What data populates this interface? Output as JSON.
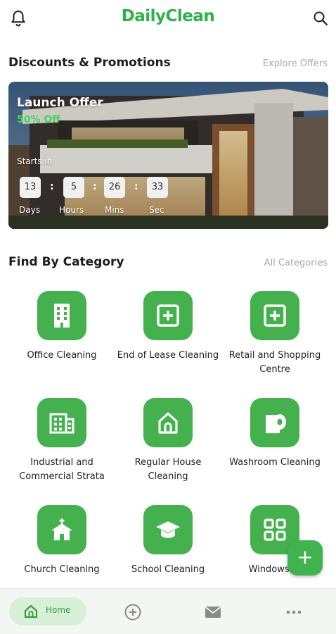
{
  "header": {
    "brand": "DailyClean",
    "bell_icon": "bell-icon",
    "search_icon": "search-icon"
  },
  "promotions": {
    "title": "Discounts & Promotions",
    "link": "Explore Offers",
    "banner": {
      "title": "Launch Offer",
      "subtitle": "50% Off",
      "starts_label": "Starts in",
      "countdown": [
        {
          "value": "13",
          "unit": "Days"
        },
        {
          "value": "5",
          "unit": "Hours"
        },
        {
          "value": "26",
          "unit": "Mins"
        },
        {
          "value": "33",
          "unit": "Sec"
        }
      ]
    }
  },
  "categories": {
    "title": "Find By Category",
    "link": "All Categories",
    "items": [
      {
        "label": "Office Cleaning",
        "icon": "office-building-icon"
      },
      {
        "label": "End of Lease Cleaning",
        "icon": "plus-box-icon"
      },
      {
        "label": "Retail and Shopping Centre",
        "icon": "plus-box-icon"
      },
      {
        "label": "Industrial and Commercial Strata",
        "icon": "apartment-building-icon"
      },
      {
        "label": "Regular House Cleaning",
        "icon": "house-icon"
      },
      {
        "label": "Washroom Cleaning",
        "icon": "toilet-paper-icon"
      },
      {
        "label": "Church Cleaning",
        "icon": "church-icon"
      },
      {
        "label": "School Cleaning",
        "icon": "graduation-cap-icon"
      },
      {
        "label": "Windows Cl",
        "icon": "windows-grid-icon"
      }
    ]
  },
  "fab": {
    "label": "+"
  },
  "bottom_nav": {
    "home_label": "Home",
    "icons": [
      "home-icon",
      "add-circle-icon",
      "mail-icon",
      "more-icon"
    ]
  },
  "colors": {
    "brand": "#2eb14a",
    "category_bg": "#45b14e",
    "offer_text": "#3ed85f"
  }
}
